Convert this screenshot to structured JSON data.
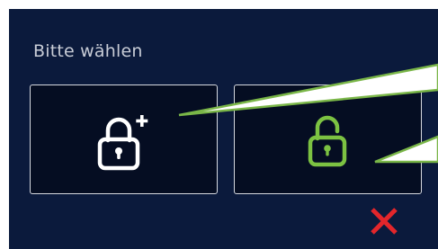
{
  "dialog": {
    "prompt": "Bitte wählen"
  },
  "options": [
    {
      "icon": "lock-add-icon",
      "color": "#ffffff"
    },
    {
      "icon": "lock-open-icon",
      "color": "#7cc242"
    }
  ],
  "close": {
    "icon": "close-icon",
    "color": "#e3262b"
  },
  "colors": {
    "background": "#0b1a3c",
    "tile_background": "#050d22",
    "tile_border": "#d6d9e0",
    "accent_green": "#7cc242",
    "callout_green": "#7ab648",
    "close_red": "#e3262b"
  }
}
